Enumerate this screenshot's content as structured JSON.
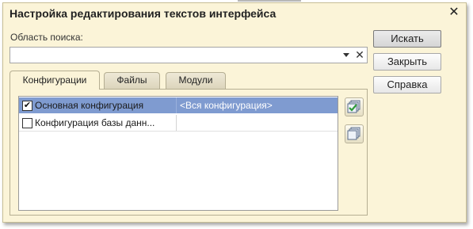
{
  "window": {
    "title": "Настройка редактирования текстов интерфейса"
  },
  "search": {
    "label": "Область поиска:",
    "value": ""
  },
  "buttons": {
    "search": "Искать",
    "close": "Закрыть",
    "help": "Справка"
  },
  "tabs": [
    {
      "label": "Конфигурации",
      "active": true
    },
    {
      "label": "Файлы",
      "active": false
    },
    {
      "label": "Модули",
      "active": false
    }
  ],
  "rows": [
    {
      "name": "Основная конфигурация",
      "value": "<Вся конфигурация>",
      "checked": true,
      "selected": true
    },
    {
      "name": "Конфигурация базы данн...",
      "value": "",
      "checked": false,
      "selected": false
    }
  ],
  "icons": {
    "close": "close-icon",
    "dropdown": "chevron-down-icon",
    "clear": "clear-icon",
    "check_all": "check-all-icon",
    "uncheck_all": "uncheck-all-icon"
  },
  "colors": {
    "window_bg": "#fbf4d8",
    "selection": "#7f9bd0",
    "check_green": "#2e9b3a"
  }
}
